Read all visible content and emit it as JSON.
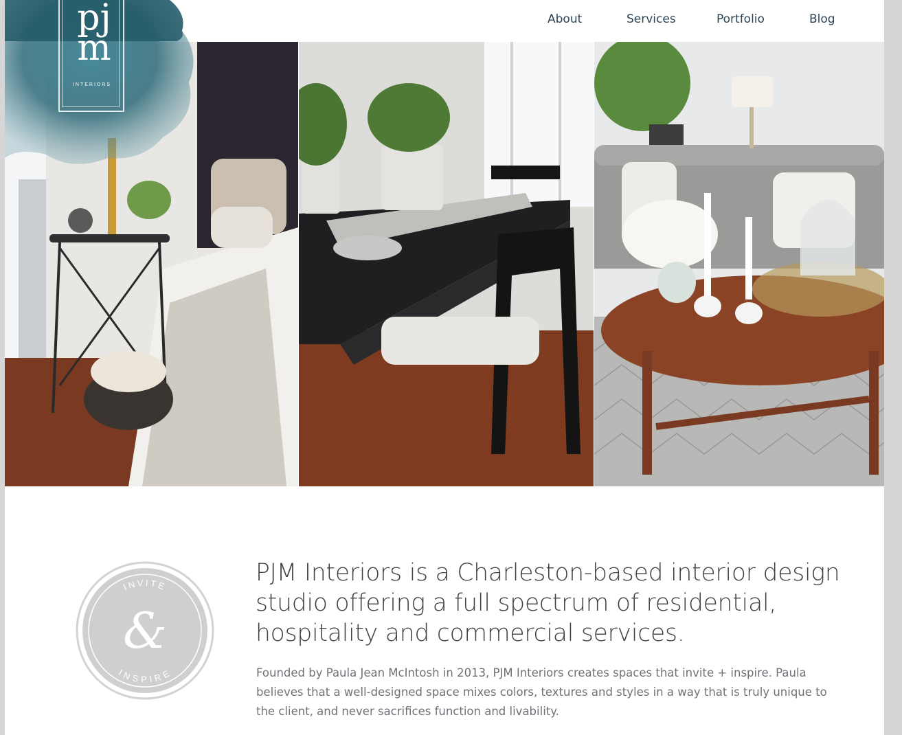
{
  "logo": {
    "letters_top": "pj",
    "letters_bottom": "m",
    "sub": "INTERIORS"
  },
  "nav": {
    "items": [
      "About",
      "Services",
      "Portfolio",
      "Blog"
    ]
  },
  "badge": {
    "top_word": "INVITE",
    "ampersand": "&",
    "bottom_word": "INSPIRE"
  },
  "intro": {
    "headline": "PJM Interiors is a Charleston-based interior design studio offering a full spectrum of residential, hospitality and commercial services.",
    "body": "Founded by Paula Jean McIntosh in 2013, PJM Interiors creates spaces that invite + inspire. Paula believes that a well-designed space mixes colors, textures and styles in a way that is truly unique to the client, and never sacrifices function and livability."
  },
  "colors": {
    "nav": "#2c4353",
    "brand_blob": "#2f6b7a",
    "headline": "#3f4144",
    "body": "#6e7276"
  }
}
